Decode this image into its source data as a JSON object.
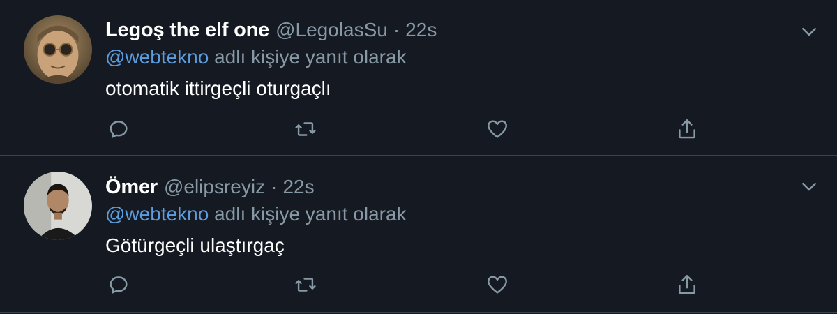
{
  "tweets": [
    {
      "display_name": "Legoş the elf one",
      "handle": "@LegolasSu",
      "separator": "·",
      "time": "22s",
      "reply_mention": "@webtekno",
      "reply_suffix": " adlı kişiye yanıt olarak",
      "text": "otomatik ittirgeçli oturgaçlı"
    },
    {
      "display_name": "Ömer",
      "handle": "@elipsreyiz",
      "separator": "·",
      "time": "22s",
      "reply_mention": "@webtekno",
      "reply_suffix": " adlı kişiye yanıt olarak",
      "text": "Götürgeçli ulaştırgaç"
    }
  ],
  "icons": {
    "reply": "reply-icon",
    "retweet": "retweet-icon",
    "like": "heart-icon",
    "share": "share-icon",
    "more": "chevron-down-icon"
  },
  "colors": {
    "background": "#151a22",
    "divider": "#38444d",
    "name": "#ffffff",
    "secondary": "#8899a6",
    "mention": "#5c9de0",
    "icon": "#8899a6"
  }
}
